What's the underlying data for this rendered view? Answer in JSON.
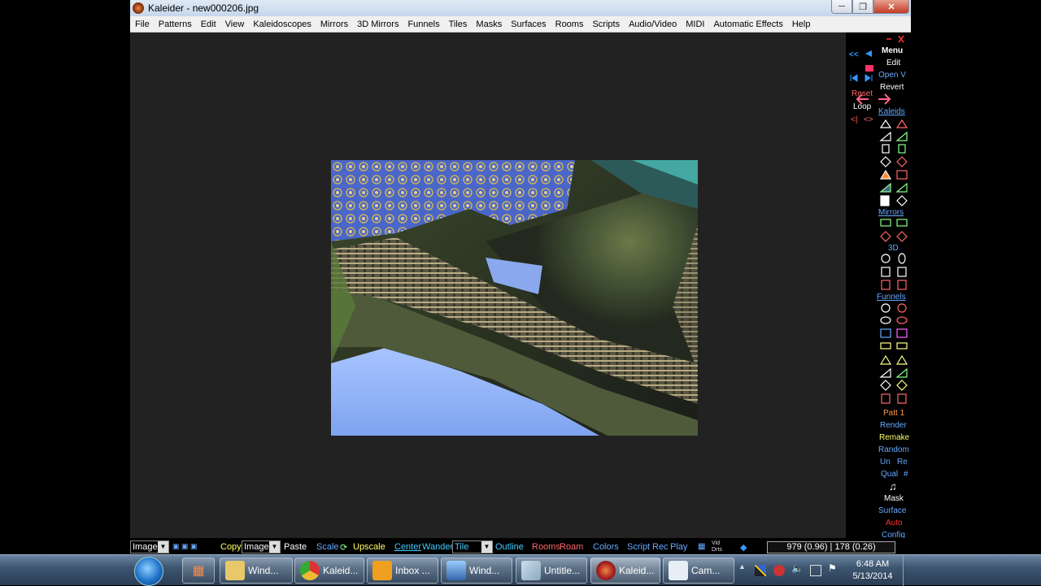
{
  "window": {
    "title": "Kaleider - new000206.jpg",
    "controls": {
      "minimize": "─",
      "maximize": "❐",
      "close": "✕"
    }
  },
  "menu": [
    "File",
    "Patterns",
    "Edit",
    "View",
    "Kaleidoscopes",
    "Mirrors",
    "3D Mirrors",
    "Funnels",
    "Tiles",
    "Masks",
    "Surfaces",
    "Rooms",
    "Scripts",
    "Audio/Video",
    "MIDI",
    "Automatic Effects",
    "Help"
  ],
  "panel": {
    "nav": {
      "rewind": "<<",
      "reset": "Reset",
      "loop": "Loop",
      "step": "<|",
      "bounce": "<>"
    },
    "top_labels": {
      "menu": "Menu",
      "edit": "Edit",
      "open": "Open V",
      "revert": "Revert"
    },
    "sections": {
      "kaleids": "Kaleids",
      "mirrors": "Mirrors",
      "three_d": "3D",
      "funnels": "Funnels"
    },
    "bottom": {
      "patt": "Patt 1",
      "render": "Render",
      "remake": "Remake",
      "random": "Random",
      "undo": "Un",
      "redo": "Re",
      "qual": "Qual",
      "hash": "#",
      "mask": "Mask",
      "surface": "Surface",
      "auto": "Auto",
      "config": "Config",
      "help": "?"
    }
  },
  "toolbar": {
    "image_select": "Image",
    "copy": "Copy",
    "copy_select": "Image",
    "paste": "Paste",
    "scale": "Scale",
    "upscale": "Upscale",
    "center": "Center",
    "wander": "Wander",
    "tile_select": "Tile",
    "outline": "Outline",
    "rooms": "Rooms",
    "roam": "Roam",
    "colors": "Colors",
    "script": "Script",
    "rec": "Rec",
    "play": "Play",
    "coords": "979 (0.96) | 178 (0.26)",
    "vid": "Vid",
    "drts": "Drts"
  },
  "taskbar": {
    "items": [
      {
        "label": "Wind...",
        "icon": "folder-icon"
      },
      {
        "label": "Kaleid...",
        "icon": "chrome-icon"
      },
      {
        "label": "Inbox ...",
        "icon": "outlook-icon"
      },
      {
        "label": "Wind...",
        "icon": "window-icon"
      },
      {
        "label": "Untitle...",
        "icon": "paint-icon"
      },
      {
        "label": "Kaleid...",
        "icon": "kaleider-icon"
      },
      {
        "label": "Cam...",
        "icon": "camtasia-icon"
      }
    ],
    "time": "6:48 AM",
    "date": "5/13/2014"
  },
  "colors": {
    "panel_yellow": "#ffff66",
    "panel_orange": "#ff9944",
    "panel_blue": "#66aaff",
    "panel_red": "#ff3333",
    "panel_white": "#ffffff",
    "toolbar_cyan": "#44ccff"
  }
}
